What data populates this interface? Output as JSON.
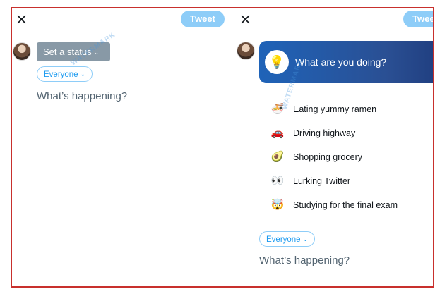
{
  "left_panel": {
    "tweet_label": "Tweet",
    "status_button_label": "Set a status",
    "audience_label": "Everyone",
    "placeholder": "What’s happening?"
  },
  "right_panel": {
    "tweet_label": "Twee",
    "status_card_title": "What are you doing?",
    "status_options": [
      {
        "icon": "ramen-icon",
        "label": "Eating yummy ramen"
      },
      {
        "icon": "car-icon",
        "label": "Driving highway"
      },
      {
        "icon": "avocado-icon",
        "label": "Shopping grocery"
      },
      {
        "icon": "eyes-icon",
        "label": "Lurking Twitter"
      },
      {
        "icon": "mind-blown-icon",
        "label": "Studying for the final exam"
      }
    ],
    "audience_label": "Everyone",
    "placeholder": "What’s happening?"
  },
  "colors": {
    "accent": "#1d9bf0",
    "tweet_button": "#8ecdf8",
    "status_button": "#8899a6",
    "frame_border": "#c8302d"
  }
}
